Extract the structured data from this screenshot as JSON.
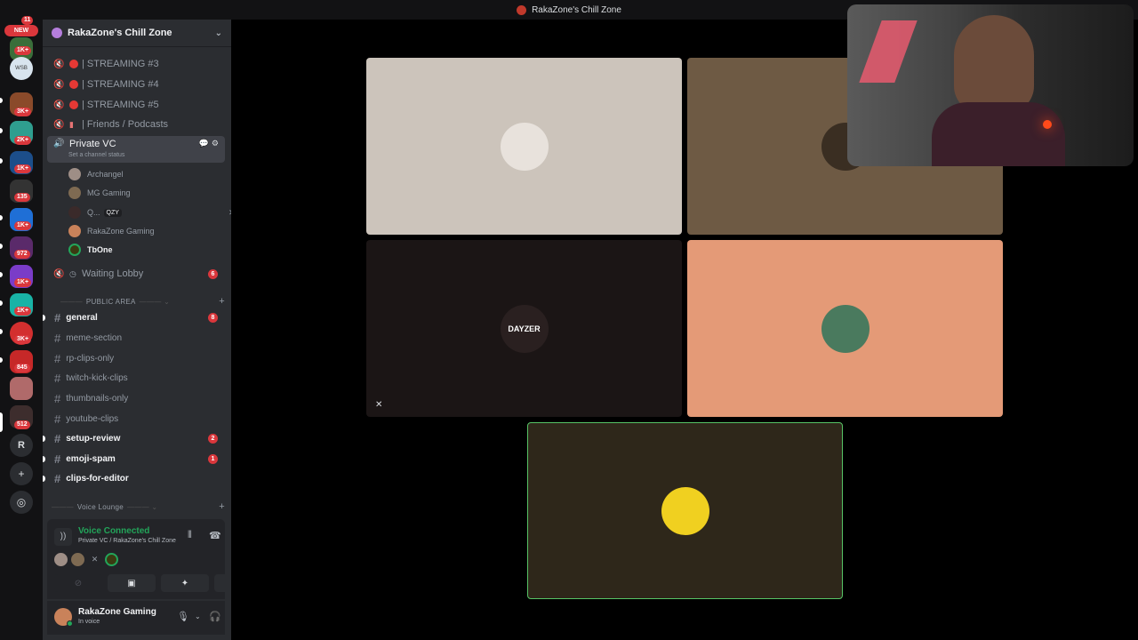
{
  "window": {
    "title": "RakaZone's Chill Zone"
  },
  "rail": {
    "new_label": "NEW",
    "badges": [
      "1K+",
      "3K+",
      "2K+",
      "1K+",
      "135",
      "1K+",
      "972",
      "1K+",
      "1K+",
      "3K+",
      "845",
      "512"
    ],
    "top_badge": "11",
    "initial_server": "R",
    "server_label_wsb": "WSB"
  },
  "server": {
    "name": "RakaZone's Chill Zone"
  },
  "voice_channels": [
    {
      "label": "| STREAMING #3"
    },
    {
      "label": "| STREAMING #4"
    },
    {
      "label": "| STREAMING #5"
    },
    {
      "label": "| Friends / Podcasts"
    }
  ],
  "active_channel": {
    "name": "Private VC",
    "status_placeholder": "Set a channel status"
  },
  "members": [
    {
      "name": "Archangel"
    },
    {
      "name": "MG Gaming"
    },
    {
      "name": "Q...",
      "tag": "QZY"
    },
    {
      "name": "RakaZone Gaming"
    },
    {
      "name": "TbOne"
    }
  ],
  "waiting_lobby": {
    "label": "Waiting Lobby",
    "count": "6"
  },
  "public_area": {
    "label": "PUBLIC AREA",
    "channels": [
      {
        "name": "general",
        "count": "8"
      },
      {
        "name": "meme-section"
      },
      {
        "name": "rp-clips-only"
      },
      {
        "name": "twitch-kick-clips"
      },
      {
        "name": "thumbnails-only"
      },
      {
        "name": "youtube-clips"
      },
      {
        "name": "setup-review",
        "count": "2"
      },
      {
        "name": "emoji-spam",
        "count": "1"
      },
      {
        "name": "clips-for-editor"
      }
    ]
  },
  "voice_lounge": {
    "label": "Voice Lounge"
  },
  "voice_panel": {
    "status": "Voice Connected",
    "location": "Private VC / RakaZone's Chill Zone"
  },
  "user": {
    "name": "RakaZone Gaming",
    "status": "In voice"
  },
  "tiles": [
    {
      "label": "",
      "bg": "#ccc4bb"
    },
    {
      "label": "",
      "bg": "#6e5a44"
    },
    {
      "label": "DAYZER",
      "bg": "#1b1515"
    },
    {
      "label": "",
      "bg": "#e49a77"
    },
    {
      "label": "",
      "bg": "#2e271a"
    }
  ],
  "colors": {
    "accent_green": "#23a55a",
    "unread_red": "#da373c",
    "speaking_border": "#57c466"
  }
}
